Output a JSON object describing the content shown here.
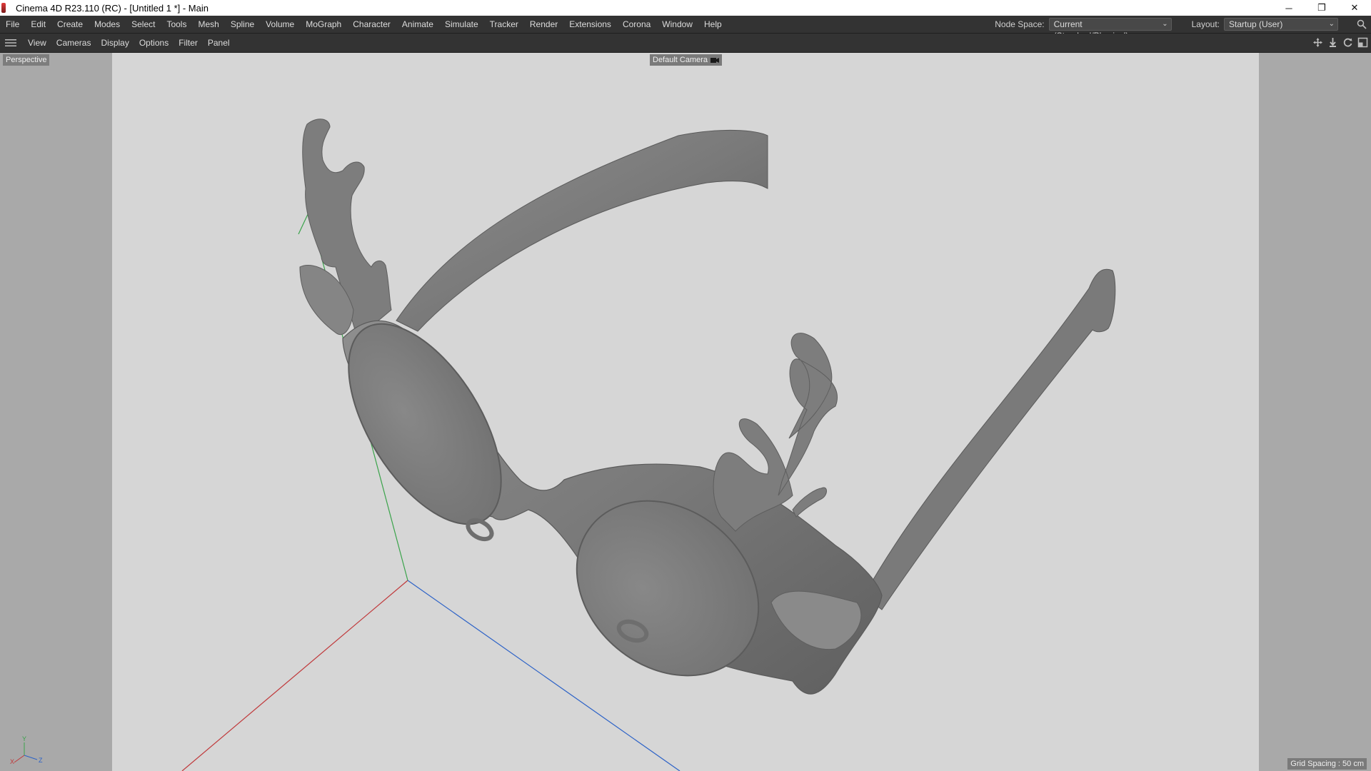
{
  "window": {
    "title": "Cinema 4D R23.110 (RC) - [Untitled 1 *] - Main",
    "controls": {
      "minimize": "─",
      "restore": "❐",
      "close": "✕"
    }
  },
  "menu": {
    "items": [
      "File",
      "Edit",
      "Create",
      "Modes",
      "Select",
      "Tools",
      "Mesh",
      "Spline",
      "Volume",
      "MoGraph",
      "Character",
      "Animate",
      "Simulate",
      "Tracker",
      "Render",
      "Extensions",
      "Corona",
      "Window",
      "Help"
    ],
    "node_space_label": "Node Space:",
    "node_space_value": "Current (Standard/Physical)",
    "layout_label": "Layout:",
    "layout_value": "Startup (User)"
  },
  "viewport_menu": {
    "items": [
      "View",
      "Cameras",
      "Display",
      "Options",
      "Filter",
      "Panel"
    ]
  },
  "viewport": {
    "projection": "Perspective",
    "camera": "Default Camera",
    "grid_spacing": "Grid Spacing : 50 cm"
  },
  "axes": {
    "x": "X",
    "y": "Y",
    "z": "Z"
  },
  "colors": {
    "viewport_bg": "#d6d6d6",
    "viewport_border": "#a9a9a9",
    "model": "#7c7c7c",
    "axis_x": "#c0393b",
    "axis_y": "#3aa34a",
    "axis_z": "#2c62c7"
  },
  "icons": {
    "window_app": "cinema4d-icon",
    "search": "search-icon",
    "menu": "hamburger-icon",
    "nav": [
      "move-view-icon",
      "zoom-view-icon",
      "rotate-view-icon",
      "maximize-view-icon"
    ],
    "camera": "camera-icon"
  }
}
